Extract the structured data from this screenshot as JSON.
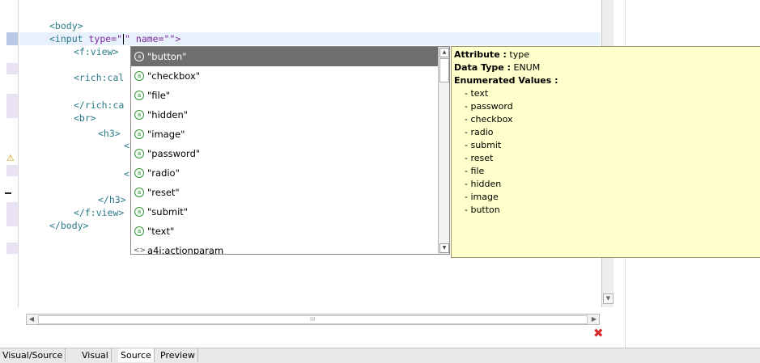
{
  "code_lines": [
    "<body>",
    "<input",
    "type=\"",
    "\"",
    "name=\"\">",
    "<f:view>",
    "<rich:cal",
    "</rich:ca",
    "<br>",
    "<h3>",
    "<",
    "<",
    "</h3>",
    "</f:view>",
    "</body>"
  ],
  "autocomplete": {
    "items": [
      {
        "label": "\"button\"",
        "icon": "attribute-value-icon",
        "selected": true
      },
      {
        "label": "\"checkbox\"",
        "icon": "attribute-value-icon"
      },
      {
        "label": "\"file\"",
        "icon": "attribute-value-icon"
      },
      {
        "label": "\"hidden\"",
        "icon": "attribute-value-icon"
      },
      {
        "label": "\"image\"",
        "icon": "attribute-value-icon"
      },
      {
        "label": "\"password\"",
        "icon": "attribute-value-icon"
      },
      {
        "label": "\"radio\"",
        "icon": "attribute-value-icon"
      },
      {
        "label": "\"reset\"",
        "icon": "attribute-value-icon"
      },
      {
        "label": "\"submit\"",
        "icon": "attribute-value-icon"
      },
      {
        "label": "\"text\"",
        "icon": "attribute-value-icon"
      },
      {
        "label": "a4j:actionparam",
        "icon": "tag-icon"
      }
    ],
    "icon_glyph": "a",
    "tag_glyph": "<>"
  },
  "info": {
    "attribute_label": "Attribute :",
    "attribute_value": "type",
    "datatype_label": "Data Type :",
    "datatype_value": "ENUM",
    "enum_label": "Enumerated Values :",
    "values": [
      "- text",
      "- password",
      "- checkbox",
      "- radio",
      "- submit",
      "- reset",
      "- file",
      "- hidden",
      "- image",
      "- button"
    ]
  },
  "scroll_grip": "III",
  "tabs": [
    {
      "label": "Visual/Source",
      "active": false
    },
    {
      "label": "Visual",
      "active": false
    },
    {
      "label": "Source",
      "active": true
    },
    {
      "label": "Preview",
      "active": false
    }
  ],
  "glyphs": {
    "warning": "⚠",
    "close": "✖",
    "left": "◀",
    "right": "▶",
    "up": "▲",
    "down": "▼"
  },
  "colors": {
    "tooltip_bg": "#ffffcc",
    "selection": "#6f6f6f",
    "tag": "#2a7a8a",
    "attr": "#7a2a9a",
    "close": "#d72a2a"
  }
}
